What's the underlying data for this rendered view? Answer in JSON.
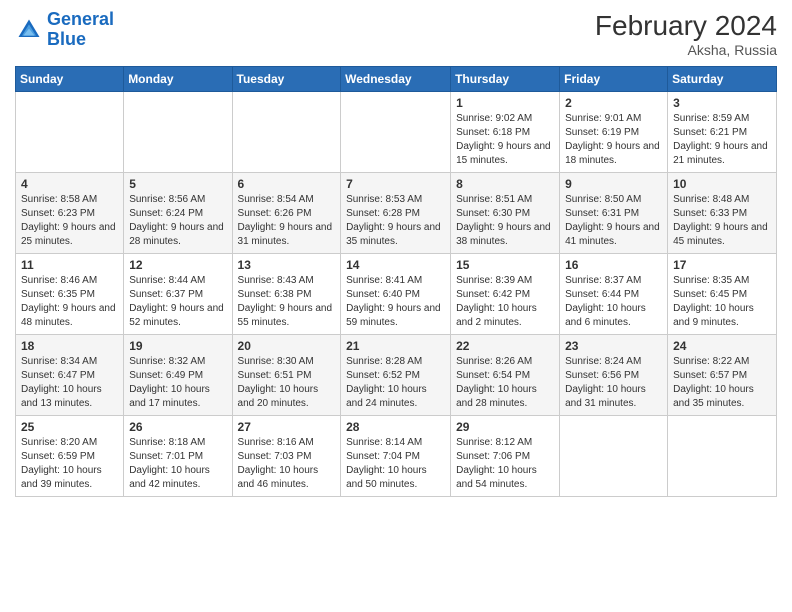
{
  "header": {
    "logo_line1": "General",
    "logo_line2": "Blue",
    "month_year": "February 2024",
    "location": "Aksha, Russia"
  },
  "weekdays": [
    "Sunday",
    "Monday",
    "Tuesday",
    "Wednesday",
    "Thursday",
    "Friday",
    "Saturday"
  ],
  "weeks": [
    [
      {
        "day": "",
        "info": ""
      },
      {
        "day": "",
        "info": ""
      },
      {
        "day": "",
        "info": ""
      },
      {
        "day": "",
        "info": ""
      },
      {
        "day": "1",
        "info": "Sunrise: 9:02 AM\nSunset: 6:18 PM\nDaylight: 9 hours and 15 minutes."
      },
      {
        "day": "2",
        "info": "Sunrise: 9:01 AM\nSunset: 6:19 PM\nDaylight: 9 hours and 18 minutes."
      },
      {
        "day": "3",
        "info": "Sunrise: 8:59 AM\nSunset: 6:21 PM\nDaylight: 9 hours and 21 minutes."
      }
    ],
    [
      {
        "day": "4",
        "info": "Sunrise: 8:58 AM\nSunset: 6:23 PM\nDaylight: 9 hours and 25 minutes."
      },
      {
        "day": "5",
        "info": "Sunrise: 8:56 AM\nSunset: 6:24 PM\nDaylight: 9 hours and 28 minutes."
      },
      {
        "day": "6",
        "info": "Sunrise: 8:54 AM\nSunset: 6:26 PM\nDaylight: 9 hours and 31 minutes."
      },
      {
        "day": "7",
        "info": "Sunrise: 8:53 AM\nSunset: 6:28 PM\nDaylight: 9 hours and 35 minutes."
      },
      {
        "day": "8",
        "info": "Sunrise: 8:51 AM\nSunset: 6:30 PM\nDaylight: 9 hours and 38 minutes."
      },
      {
        "day": "9",
        "info": "Sunrise: 8:50 AM\nSunset: 6:31 PM\nDaylight: 9 hours and 41 minutes."
      },
      {
        "day": "10",
        "info": "Sunrise: 8:48 AM\nSunset: 6:33 PM\nDaylight: 9 hours and 45 minutes."
      }
    ],
    [
      {
        "day": "11",
        "info": "Sunrise: 8:46 AM\nSunset: 6:35 PM\nDaylight: 9 hours and 48 minutes."
      },
      {
        "day": "12",
        "info": "Sunrise: 8:44 AM\nSunset: 6:37 PM\nDaylight: 9 hours and 52 minutes."
      },
      {
        "day": "13",
        "info": "Sunrise: 8:43 AM\nSunset: 6:38 PM\nDaylight: 9 hours and 55 minutes."
      },
      {
        "day": "14",
        "info": "Sunrise: 8:41 AM\nSunset: 6:40 PM\nDaylight: 9 hours and 59 minutes."
      },
      {
        "day": "15",
        "info": "Sunrise: 8:39 AM\nSunset: 6:42 PM\nDaylight: 10 hours and 2 minutes."
      },
      {
        "day": "16",
        "info": "Sunrise: 8:37 AM\nSunset: 6:44 PM\nDaylight: 10 hours and 6 minutes."
      },
      {
        "day": "17",
        "info": "Sunrise: 8:35 AM\nSunset: 6:45 PM\nDaylight: 10 hours and 9 minutes."
      }
    ],
    [
      {
        "day": "18",
        "info": "Sunrise: 8:34 AM\nSunset: 6:47 PM\nDaylight: 10 hours and 13 minutes."
      },
      {
        "day": "19",
        "info": "Sunrise: 8:32 AM\nSunset: 6:49 PM\nDaylight: 10 hours and 17 minutes."
      },
      {
        "day": "20",
        "info": "Sunrise: 8:30 AM\nSunset: 6:51 PM\nDaylight: 10 hours and 20 minutes."
      },
      {
        "day": "21",
        "info": "Sunrise: 8:28 AM\nSunset: 6:52 PM\nDaylight: 10 hours and 24 minutes."
      },
      {
        "day": "22",
        "info": "Sunrise: 8:26 AM\nSunset: 6:54 PM\nDaylight: 10 hours and 28 minutes."
      },
      {
        "day": "23",
        "info": "Sunrise: 8:24 AM\nSunset: 6:56 PM\nDaylight: 10 hours and 31 minutes."
      },
      {
        "day": "24",
        "info": "Sunrise: 8:22 AM\nSunset: 6:57 PM\nDaylight: 10 hours and 35 minutes."
      }
    ],
    [
      {
        "day": "25",
        "info": "Sunrise: 8:20 AM\nSunset: 6:59 PM\nDaylight: 10 hours and 39 minutes."
      },
      {
        "day": "26",
        "info": "Sunrise: 8:18 AM\nSunset: 7:01 PM\nDaylight: 10 hours and 42 minutes."
      },
      {
        "day": "27",
        "info": "Sunrise: 8:16 AM\nSunset: 7:03 PM\nDaylight: 10 hours and 46 minutes."
      },
      {
        "day": "28",
        "info": "Sunrise: 8:14 AM\nSunset: 7:04 PM\nDaylight: 10 hours and 50 minutes."
      },
      {
        "day": "29",
        "info": "Sunrise: 8:12 AM\nSunset: 7:06 PM\nDaylight: 10 hours and 54 minutes."
      },
      {
        "day": "",
        "info": ""
      },
      {
        "day": "",
        "info": ""
      }
    ]
  ]
}
